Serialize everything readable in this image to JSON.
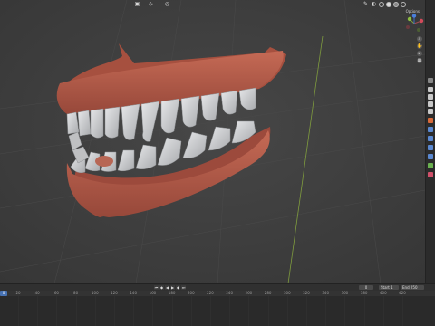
{
  "header": {
    "mode_label": "...",
    "options_label": "Options"
  },
  "timeline": {
    "current_frame": "0",
    "start_label": "Start",
    "start_value": "1",
    "end_label": "End",
    "end_value": "250",
    "ticks": [
      "0",
      "20",
      "40",
      "60",
      "80",
      "100",
      "120",
      "140",
      "160",
      "180",
      "200",
      "220",
      "240",
      "260",
      "280",
      "300",
      "320",
      "340",
      "360",
      "380",
      "400",
      "420"
    ]
  },
  "colors": {
    "viewport_bg": "#3f3f3f",
    "gum": "#b55a47",
    "teeth": "#cfd0d2",
    "x_axis": "#a44a52",
    "y_axis": "#7f9c3e",
    "z_axis": "#3c6dc3"
  }
}
